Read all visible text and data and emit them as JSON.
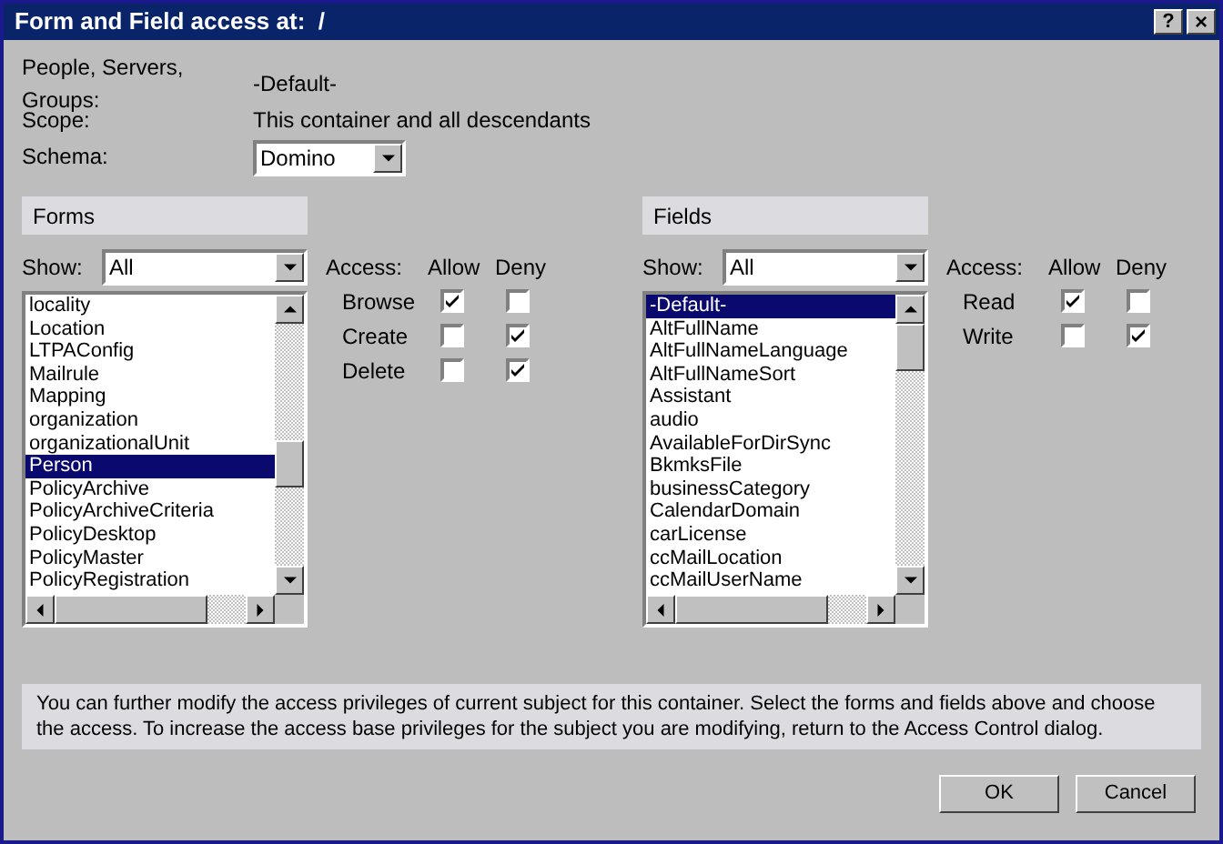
{
  "window": {
    "title": "Form and Field access at:  /",
    "help_button": "?",
    "close_button": "×"
  },
  "info": [
    {
      "label": "People, Servers, Groups:",
      "value": "-Default-"
    },
    {
      "label": "Scope:",
      "value": "This container and all descendants"
    }
  ],
  "schema": {
    "label": "Schema:",
    "value": "Domino"
  },
  "panels": [
    {
      "header": "Forms",
      "show_label": "Show:",
      "show_value": "All",
      "items": [
        {
          "label": "locality",
          "selected": false
        },
        {
          "label": "Location",
          "selected": false
        },
        {
          "label": "LTPAConfig",
          "selected": false
        },
        {
          "label": "Mailrule",
          "selected": false
        },
        {
          "label": "Mapping",
          "selected": false
        },
        {
          "label": "organization",
          "selected": false
        },
        {
          "label": "organizationalUnit",
          "selected": false
        },
        {
          "label": "Person",
          "selected": true
        },
        {
          "label": "PolicyArchive",
          "selected": false
        },
        {
          "label": "PolicyArchiveCriteria",
          "selected": false
        },
        {
          "label": "PolicyDesktop",
          "selected": false
        },
        {
          "label": "PolicyMaster",
          "selected": false
        },
        {
          "label": "PolicyRegistration",
          "selected": false
        }
      ],
      "access_label": "Access:",
      "allow_label": "Allow",
      "deny_label": "Deny",
      "rights": [
        {
          "label": "Browse",
          "allow": true,
          "deny": false
        },
        {
          "label": "Create",
          "allow": false,
          "deny": true
        },
        {
          "label": "Delete",
          "allow": false,
          "deny": true
        }
      ]
    },
    {
      "header": "Fields",
      "show_label": "Show:",
      "show_value": "All",
      "items": [
        {
          "label": "-Default-",
          "selected": true
        },
        {
          "label": "AltFullName",
          "selected": false
        },
        {
          "label": "AltFullNameLanguage",
          "selected": false
        },
        {
          "label": "AltFullNameSort",
          "selected": false
        },
        {
          "label": "Assistant",
          "selected": false
        },
        {
          "label": "audio",
          "selected": false
        },
        {
          "label": "AvailableForDirSync",
          "selected": false
        },
        {
          "label": "BkmksFile",
          "selected": false
        },
        {
          "label": "businessCategory",
          "selected": false
        },
        {
          "label": "CalendarDomain",
          "selected": false
        },
        {
          "label": "carLicense",
          "selected": false
        },
        {
          "label": "ccMailLocation",
          "selected": false
        },
        {
          "label": "ccMailUserName",
          "selected": false
        }
      ],
      "access_label": "Access:",
      "allow_label": "Allow",
      "deny_label": "Deny",
      "rights": [
        {
          "label": "Read",
          "allow": true,
          "deny": false
        },
        {
          "label": "Write",
          "allow": false,
          "deny": true
        }
      ]
    }
  ],
  "note": "You can further modify the access privileges of current subject for this container.  Select the forms and fields above and choose the access. To increase the access base privileges for the subject you are modifying, return to the Access Control dialog.",
  "buttons": [
    "OK",
    "Cancel"
  ]
}
